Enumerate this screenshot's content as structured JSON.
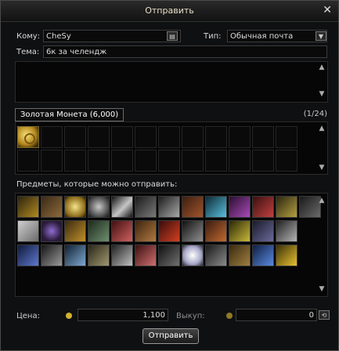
{
  "window": {
    "title": "Отправить",
    "close_glyph": "✕"
  },
  "to": {
    "label": "Кому:",
    "value": "CheSy"
  },
  "type": {
    "label": "Тип:",
    "value": "Обычная почта"
  },
  "subject": {
    "label": "Тема:",
    "value": "6к за челендж"
  },
  "attachment": {
    "tooltip": "Золотая Монета (6,000)",
    "counter": "(1/24)"
  },
  "inventory": {
    "heading": "Предметы, которые можно отправить:"
  },
  "price": {
    "label": "Цена:",
    "value": "1,100",
    "buyout_label": "Выкуп:",
    "buyout_value": "0"
  },
  "send_button": "Отправить",
  "colors": {
    "accent": "#d2b130",
    "frame": "#4a4a4a"
  }
}
